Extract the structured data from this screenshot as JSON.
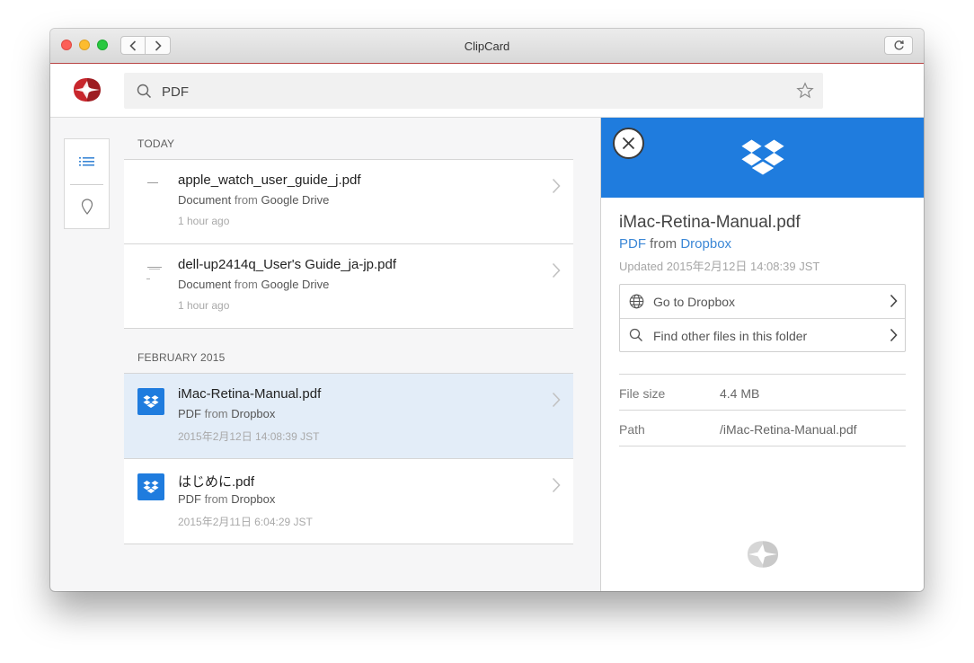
{
  "window": {
    "title": "ClipCard"
  },
  "search": {
    "value": "PDF",
    "placeholder": ""
  },
  "sections": [
    {
      "title": "TODAY",
      "items": [
        {
          "name": "apple_watch_user_guide_j.pdf",
          "type": "Document",
          "from_word": "from",
          "source": "Google Drive",
          "time": "1 hour ago",
          "icon": "document-thumbnail-icon"
        },
        {
          "name": "dell-up2414q_User's Guide_ja-jp.pdf",
          "type": "Document",
          "from_word": "from",
          "source": "Google Drive",
          "time": "1 hour ago",
          "icon": "document-thumbnail-icon"
        }
      ]
    },
    {
      "title": "FEBRUARY 2015",
      "items": [
        {
          "name": "iMac-Retina-Manual.pdf",
          "type": "PDF",
          "from_word": "from",
          "source": "Dropbox",
          "time": "2015年2月12日 14:08:39 JST",
          "icon": "dropbox-icon",
          "selected": true
        },
        {
          "name": "はじめに.pdf",
          "type": "PDF",
          "from_word": "from",
          "source": "Dropbox",
          "time": "2015年2月11日 6:04:29 JST",
          "icon": "dropbox-icon"
        }
      ]
    }
  ],
  "detail": {
    "title": "iMac-Retina-Manual.pdf",
    "type": "PDF",
    "from_word": "from",
    "source": "Dropbox",
    "updated": "Updated 2015年2月12日 14:08:39 JST",
    "actions": [
      {
        "label": "Go to Dropbox",
        "icon": "globe-icon"
      },
      {
        "label": "Find other files in this folder",
        "icon": "search-icon"
      }
    ],
    "properties": [
      {
        "key": "File size",
        "value": "4.4 MB"
      },
      {
        "key": "Path",
        "value": "/iMac-Retina-Manual.pdf"
      }
    ]
  },
  "colors": {
    "accent": "#1f7cde",
    "brand_red": "#c8262c",
    "selected_row": "#e3edf8",
    "link_blue": "#3b87d6"
  }
}
